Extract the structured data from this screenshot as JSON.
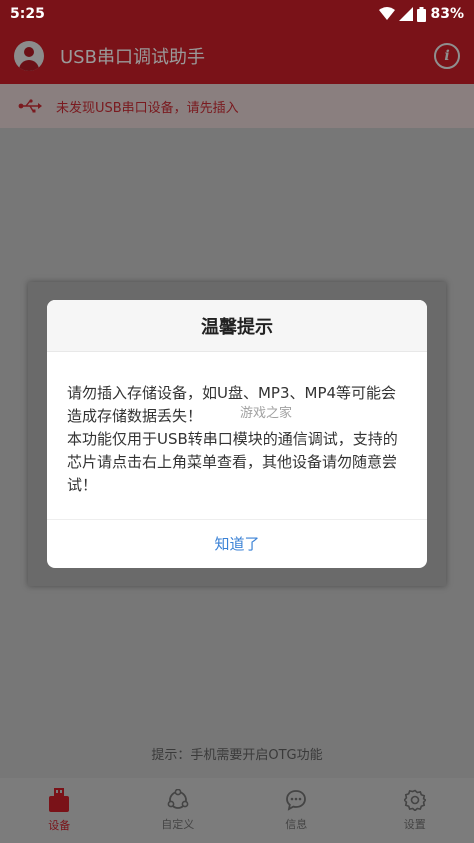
{
  "status_bar": {
    "time": "5:25",
    "battery": "83%"
  },
  "app_bar": {
    "title": "USB串口调试助手",
    "info_icon": "info-icon"
  },
  "notice": {
    "text": "未发现USB串口设备，请先插入",
    "icon": "usb-icon"
  },
  "dialog": {
    "title": "温馨提示",
    "line1": "请勿插入存储设备，如U盘、MP3、MP4等可能会造成存储数据丢失！",
    "line2": "本功能仅用于USB转串口模块的通信调试，支持的芯片请点击右上角菜单查看，其他设备请勿随意尝试！",
    "confirm": "知道了"
  },
  "watermark": "游戏之家",
  "hint": "提示：手机需要开启OTG功能",
  "nav": [
    {
      "label": "设备",
      "icon": "usb-device-icon",
      "active": true
    },
    {
      "label": "自定义",
      "icon": "custom-icon",
      "active": false
    },
    {
      "label": "信息",
      "icon": "message-icon",
      "active": false
    },
    {
      "label": "设置",
      "icon": "settings-gear-icon",
      "active": false
    }
  ],
  "colors": {
    "primary": "#7a1218",
    "dialog_action": "#3b82d6"
  }
}
